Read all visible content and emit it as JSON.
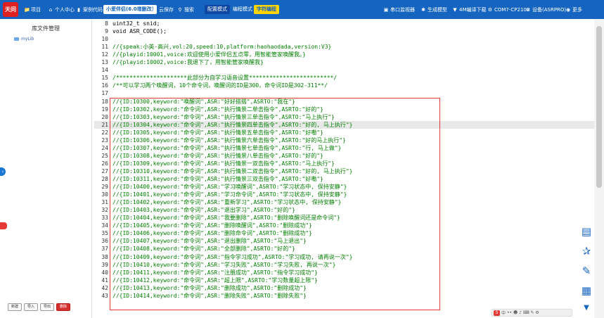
{
  "toolbar": {
    "logo_text": "天问",
    "items": [
      {
        "label": "项目",
        "icon": "folder-icon"
      },
      {
        "label": "个人中心",
        "icon": "home-icon"
      },
      {
        "label": "案例代码",
        "icon": "code-icon"
      }
    ],
    "project_name": "小爱伴侣(6.0增删改)",
    "save_label": "云保存",
    "search_label": "搜索",
    "mode_config": "配置模式",
    "mode_program": "编程模式",
    "mode_char": "字符编程",
    "serial_monitor": "串口监视器",
    "generate_model": "生成模型",
    "download": "4M编译下载",
    "port": "COM7-CP210x",
    "device": "设备(ASRPRO)",
    "more": "更多",
    "accent": "#1565c0"
  },
  "sidebar": {
    "title": "库文件管理",
    "lib_name": "myLib",
    "buttons": [
      "新建",
      "导入",
      "导出",
      "删除"
    ]
  },
  "editor": {
    "lines": [
      {
        "n": "8",
        "text": "uint32_t snid;",
        "cls": "c-plain"
      },
      {
        "n": "9",
        "text": "void ASR_CODE();",
        "cls": "c-plain"
      },
      {
        "n": "10",
        "text": "",
        "cls": "c-plain"
      },
      {
        "n": "11",
        "text": "//{speak:小英-高兴,vol:20,speed:10,platform:haohaodada,version:V3}",
        "cls": "c-green"
      },
      {
        "n": "12",
        "text": "//{playid:10001,voice:欢迎使用小爱伴侣五点零，用智能管家唤醒我。}",
        "cls": "c-green"
      },
      {
        "n": "13",
        "text": "//{playid:10002,voice:我退下了，用智能管家唤醒我}",
        "cls": "c-green"
      },
      {
        "n": "14",
        "text": "",
        "cls": "c-plain"
      },
      {
        "n": "15",
        "text": "/*********************此部分为自学习语音设置*************************/",
        "cls": "c-green"
      },
      {
        "n": "16",
        "text": "/**可以学习两个唤醒词，10个命令词，唤醒词的ID是300，命令词ID是302-311**/",
        "cls": "c-green"
      },
      {
        "n": "17",
        "text": "",
        "cls": "c-plain"
      },
      {
        "n": "18",
        "text": "//{ID:10300,keyword:\"唤醒词\",ASR:\"好好搭搭\",ASRTO:\"我在\"}",
        "cls": "c-green"
      },
      {
        "n": "19",
        "text": "//{ID:10302,keyword:\"命令词\",ASR:\"执行情景二单击指令\",ASRTO:\"好的\"}",
        "cls": "c-green"
      },
      {
        "n": "20",
        "text": "//{ID:10303,keyword:\"命令词\",ASR:\"执行情景三单击指令\",ASRTO:\"马上执行\"}",
        "cls": "c-green"
      },
      {
        "n": "21",
        "text": "//{ID:10304,keyword:\"命令词\",ASR:\"执行情景四单击指令\",ASRTO:\"好的, 马上执行\"}",
        "cls": "c-green",
        "hl": true
      },
      {
        "n": "22",
        "text": "//{ID:10305,keyword:\"命令词\",ASR:\"执行情景五单击指令\",ASRTO:\"好嘞\"}",
        "cls": "c-green"
      },
      {
        "n": "23",
        "text": "//{ID:10306,keyword:\"命令词\",ASR:\"执行情景六单击指令\",ASRTO:\"好的马上执行\"}",
        "cls": "c-green"
      },
      {
        "n": "24",
        "text": "//{ID:10307,keyword:\"命令词\",ASR:\"执行情景七单击指令\",ASRTO:\"行, 马上做\"}",
        "cls": "c-green"
      },
      {
        "n": "25",
        "text": "//{ID:10308,keyword:\"命令词\",ASR:\"执行情景八单击指令\",ASRTO:\"好的\"}",
        "cls": "c-green"
      },
      {
        "n": "26",
        "text": "//{ID:10309,keyword:\"命令词\",ASR:\"执行情景一双击指令\",ASRTO:\"马上执行\"}",
        "cls": "c-green"
      },
      {
        "n": "27",
        "text": "//{ID:10310,keyword:\"命令词\",ASR:\"执行情景二双击指令\",ASRTO:\"好的, 马上执行\"}",
        "cls": "c-green"
      },
      {
        "n": "28",
        "text": "//{ID:10311,keyword:\"命令词\",ASR:\"执行情景三双击指令\",ASRTO:\"好嘞\"}",
        "cls": "c-green"
      },
      {
        "n": "29",
        "text": "//{ID:10400,keyword:\"命令词\",ASR:\"学习唤醒词\",ASRTO:\"学习状态中, 保持安静\"}",
        "cls": "c-green"
      },
      {
        "n": "30",
        "text": "//{ID:10401,keyword:\"命令词\",ASR:\"学习命令词\",ASRTO:\"学习状态中, 保持安静\"}",
        "cls": "c-green"
      },
      {
        "n": "31",
        "text": "//{ID:10402,keyword:\"命令词\",ASR:\"重新学习\",ASRTO:\"学习状态中, 保持安静\"}",
        "cls": "c-green"
      },
      {
        "n": "32",
        "text": "//{ID:10403,keyword:\"命令词\",ASR:\"退出学习\",ASRTO:\"好的\"}",
        "cls": "c-green"
      },
      {
        "n": "33",
        "text": "//{ID:10404,keyword:\"命令词\",ASR:\"我要删除\",ASRTO:\"删除唤醒词还是命令词\"}",
        "cls": "c-green"
      },
      {
        "n": "34",
        "text": "//{ID:10405,keyword:\"命令词\",ASR:\"删除唤醒词\",ASRTO:\"删除成功\"}",
        "cls": "c-green"
      },
      {
        "n": "35",
        "text": "//{ID:10406,keyword:\"命令词\",ASR:\"删除命令词\",ASRTO:\"删除成功\"}",
        "cls": "c-green"
      },
      {
        "n": "36",
        "text": "//{ID:10407,keyword:\"命令词\",ASR:\"退出删除\",ASRTO:\"马上退出\"}",
        "cls": "c-green"
      },
      {
        "n": "37",
        "text": "//{ID:10408,keyword:\"命令词\",ASR:\"全部删除\",ASRTO:\"好的\"}",
        "cls": "c-green"
      },
      {
        "n": "38",
        "text": "//{ID:10409,keyword:\"命令词\",ASR:\"指令学习成功\",ASRTO:\"学习成功, 请再说一次\"}",
        "cls": "c-green"
      },
      {
        "n": "39",
        "text": "//{ID:10410,keyword:\"命令词\",ASR:\"学习失败\",ASRTO:\"学习失败, 再说一次\"}",
        "cls": "c-green"
      },
      {
        "n": "40",
        "text": "//{ID:10411,keyword:\"命令词\",ASR:\"注册成功\",ASRTO:\"指令学习成功\"}",
        "cls": "c-green"
      },
      {
        "n": "41",
        "text": "//{ID:10412,keyword:\"命令词\",ASR:\"超上限\",ASRTO:\"学习数量超上限\"}",
        "cls": "c-green"
      },
      {
        "n": "42",
        "text": "//{ID:10413,keyword:\"命令词\",ASR:\"删除成功\",ASRTO:\"删除成功\"}",
        "cls": "c-green"
      },
      {
        "n": "43",
        "text": "//{ID:10414,keyword:\"命令词\",ASR:\"删除失败\",ASRTO:\"删除失败\"}",
        "cls": "c-green"
      }
    ]
  },
  "ime": {
    "badge": "S",
    "label": "中"
  }
}
